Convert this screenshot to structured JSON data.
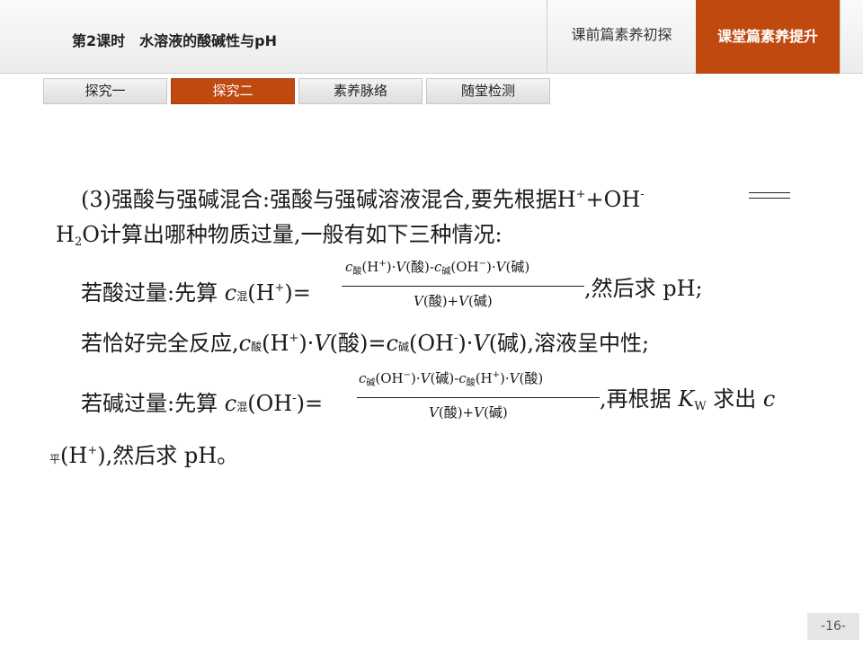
{
  "header": {
    "lesson_title": "第2课时　水溶液的酸碱性与pH",
    "nav_pre": "课前篇素养初探",
    "nav_class": "课堂篇素养提升"
  },
  "subtabs": [
    "探究一",
    "探究二",
    "素养脉络",
    "随堂检测"
  ],
  "active_subtab": "探究二",
  "body": {
    "l1": "(3)强酸与强碱混合:强酸与强碱溶液混合,要先根据H",
    "l1_sup1": "+",
    "l1_mid": "+OH",
    "l1_sup2": "-",
    "l2_a": "H",
    "l2_sub": "2",
    "l2_b": "O计算出哪种物质过量,一般有如下三种情况:",
    "l3_a": "若酸过量:先算",
    "l3_c": "c",
    "l3_sub": "混",
    "l3_b": "(H",
    "l3_sup": "+",
    "l3_c2": ")=",
    "l3_end": ",然后求 pH;",
    "f1_num_c1": "c",
    "f1_num_s1": "酸",
    "f1_num_p1": "(H",
    "f1_num_sp1": "+",
    "f1_num_p2": ")·",
    "f1_num_v1": "V",
    "f1_num_p3": "(酸)-",
    "f1_num_c2": "c",
    "f1_num_s2": "碱",
    "f1_num_p4": "(OH",
    "f1_num_sp2": "−",
    "f1_num_p5": ")·",
    "f1_num_v2": "V",
    "f1_num_p6": "(碱)",
    "f1_den_v1": "V",
    "f1_den_p1": "(酸)+",
    "f1_den_v2": "V",
    "f1_den_p2": "(碱)",
    "l4_a": "若恰好完全反应,",
    "l4_c": "c",
    "l4_s1": "酸",
    "l4_b": "(H",
    "l4_sp1": "+",
    "l4_d": ")·",
    "l4_v1": "V",
    "l4_e": "(酸)=",
    "l4_c2": "c",
    "l4_s2": "碱",
    "l4_f": "(OH",
    "l4_sp2": "-",
    "l4_g": ")·",
    "l4_v2": "V",
    "l4_h": "(碱),溶液呈中性;",
    "l5_a": "若碱过量:先算",
    "l5_c": "c",
    "l5_sub": "混",
    "l5_b": "(OH",
    "l5_sup": "-",
    "l5_c2": ")=",
    "l5_end_a": ",再根据",
    "l5_k": "K",
    "l5_w": "W",
    "l5_end_b": "求出",
    "l5_c3": "c",
    "f2_num_c1": "c",
    "f2_num_s1": "碱",
    "f2_num_p1": "(OH",
    "f2_num_sp1": "−",
    "f2_num_p2": ")·",
    "f2_num_v1": "V",
    "f2_num_p3": "(碱)-",
    "f2_num_c2": "c",
    "f2_num_s2": "酸",
    "f2_num_p4": "(H",
    "f2_num_sp2": "+",
    "f2_num_p5": ")·",
    "f2_num_v2": "V",
    "f2_num_p6": "(酸)",
    "f2_den_v1": "V",
    "f2_den_p1": "(酸)+",
    "f2_den_v2": "V",
    "f2_den_p2": "(碱)",
    "l6_sub": "平",
    "l6_a": "(H",
    "l6_sup": "+",
    "l6_b": "),然后求 pH。"
  },
  "page_number": "-16-"
}
